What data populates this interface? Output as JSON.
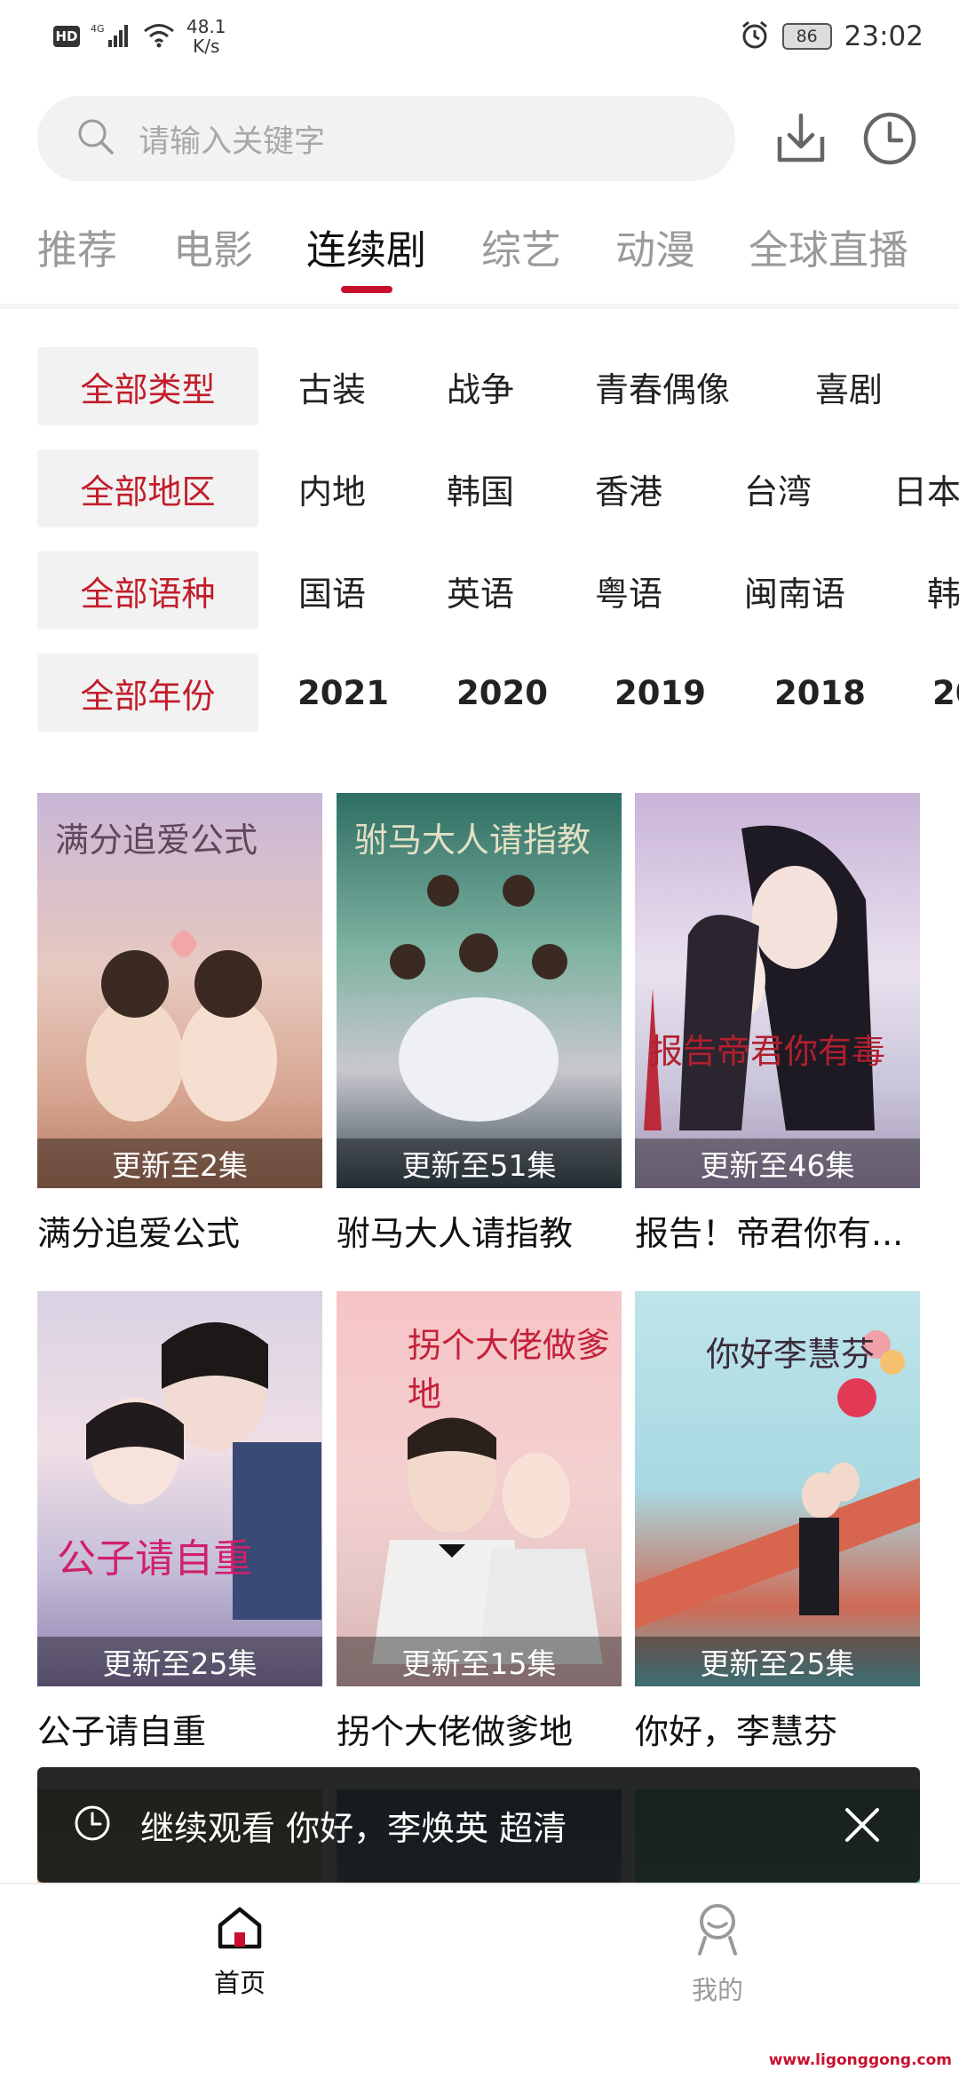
{
  "status_bar": {
    "network": "HD",
    "signal": "4G",
    "speed": "48.1\nK/s",
    "battery": "86",
    "time": "23:02"
  },
  "search": {
    "placeholder": "请输入关键字"
  },
  "tabs": [
    "推荐",
    "电影",
    "连续剧",
    "综艺",
    "动漫",
    "全球直播"
  ],
  "active_tab": "连续剧",
  "filters": {
    "type": {
      "all": "全部类型",
      "options": [
        "古装",
        "战争",
        "青春偶像",
        "喜剧"
      ]
    },
    "region": {
      "all": "全部地区",
      "options": [
        "内地",
        "韩国",
        "香港",
        "台湾",
        "日本"
      ]
    },
    "language": {
      "all": "全部语种",
      "options": [
        "国语",
        "英语",
        "粤语",
        "闽南语",
        "韩"
      ]
    },
    "year": {
      "all": "全部年份",
      "options": [
        "2021",
        "2020",
        "2019",
        "2018",
        "20"
      ]
    }
  },
  "cards": [
    {
      "title": "满分追爱公式",
      "update": "更新至2集",
      "poster_text": "满分追爱公式"
    },
    {
      "title": "驸马大人请指教",
      "update": "更新至51集",
      "poster_text": "驸马大人请指教"
    },
    {
      "title": "报告！帝君你有...",
      "update": "更新至46集",
      "poster_text": "报告帝君你有毒"
    },
    {
      "title": "公子请自重",
      "update": "更新至25集",
      "poster_text": "公子请自重"
    },
    {
      "title": "拐个大佬做爹地",
      "update": "更新至15集",
      "poster_text": "拐个大佬做爹地"
    },
    {
      "title": "你好，李慧芬",
      "update": "更新至25集",
      "poster_text": "你好李慧芬"
    }
  ],
  "continue_watching": {
    "text": "继续观看 你好，李焕英 超清"
  },
  "bottom_nav": {
    "home": "首页",
    "mine": "我的"
  },
  "watermark": "www.ligonggong.com",
  "colors": {
    "accent": "#c8102e",
    "filter_active": "#c21d2b"
  }
}
